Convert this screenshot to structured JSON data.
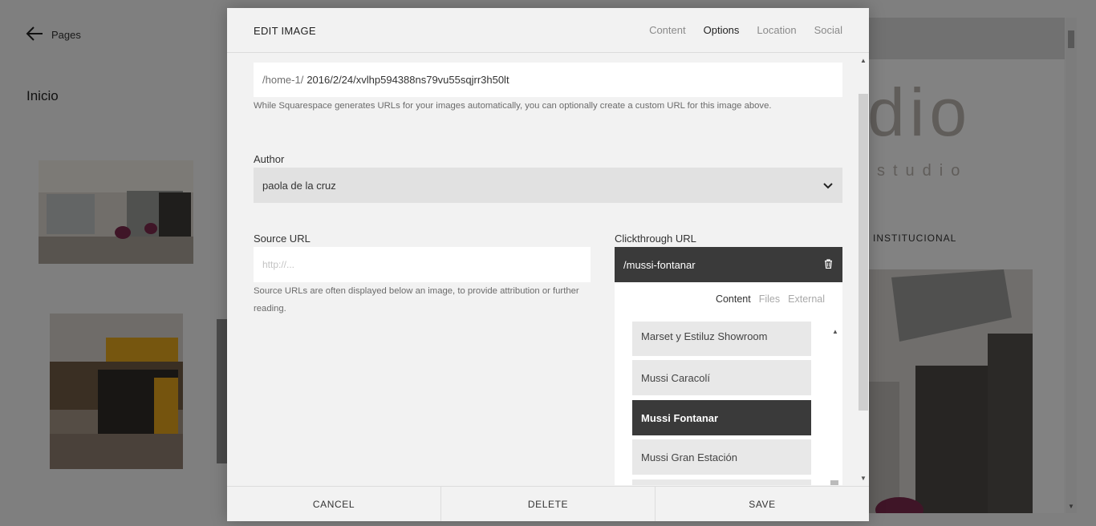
{
  "background": {
    "back_label": "Pages",
    "page_title": "Inicio",
    "preview": {
      "logo": "dio",
      "logo_sub": "studio",
      "nav_item": "INSTITUCIONAL"
    }
  },
  "modal": {
    "title": "EDIT IMAGE",
    "tabs": [
      {
        "label": "Content",
        "active": false
      },
      {
        "label": "Options",
        "active": true
      },
      {
        "label": "Location",
        "active": false
      },
      {
        "label": "Social",
        "active": false
      }
    ],
    "image_url": {
      "prefix": "/home-1/",
      "value": "2016/2/24/xvlhp594388ns79vu55sqjrr3h50lt",
      "help": "While Squarespace generates URLs for your images automatically, you can optionally create a custom URL for this image above."
    },
    "author": {
      "label": "Author",
      "value": "paola de la cruz"
    },
    "source_url": {
      "label": "Source URL",
      "placeholder": "http://...",
      "help": "Source URLs are often displayed below an image, to provide attribution or further reading."
    },
    "clickthrough": {
      "label": "Clickthrough URL",
      "value": "/mussi-fontanar",
      "picker_tabs": [
        {
          "label": "Content",
          "active": true
        },
        {
          "label": "Files",
          "active": false
        },
        {
          "label": "External",
          "active": false
        }
      ],
      "items": [
        {
          "label": "Marset y Estiluz Showroom",
          "selected": false
        },
        {
          "label": "Mussi Caracolí",
          "selected": false
        },
        {
          "label": "Mussi Fontanar",
          "selected": true
        },
        {
          "label": "Mussi Gran Estación",
          "selected": false
        }
      ]
    },
    "footer": {
      "cancel": "CANCEL",
      "delete": "DELETE",
      "save": "SAVE"
    }
  },
  "colors": {
    "overlay": "#000000",
    "selected_item_bg": "#3a3a3a",
    "modal_bg": "#f2f2f2"
  }
}
